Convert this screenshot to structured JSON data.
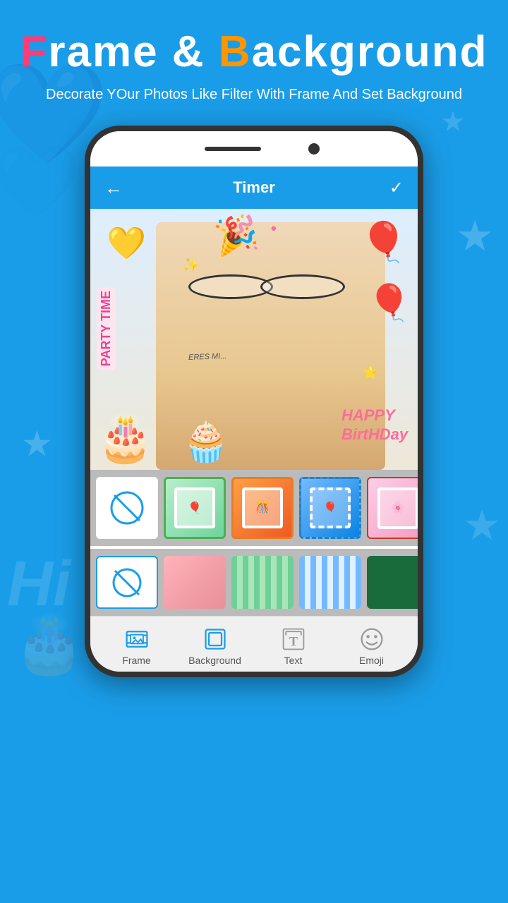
{
  "app": {
    "title_part1": "F",
    "title_rest1": "rame & ",
    "title_B": "B",
    "title_rest2": "ackground",
    "subtitle": "Decorate YOur Photos Like Filter With Frame And Set Background"
  },
  "header": {
    "back_icon": "←",
    "title": "Timer",
    "check_icon": "✓"
  },
  "frames": {
    "items": [
      {
        "id": "none",
        "label": "No frame"
      },
      {
        "id": "green",
        "label": "Green party frame"
      },
      {
        "id": "orange",
        "label": "Orange frame"
      },
      {
        "id": "blue",
        "label": "Blue party frame"
      },
      {
        "id": "pink",
        "label": "Pink frame"
      }
    ]
  },
  "backgrounds": {
    "items": [
      {
        "id": "none",
        "label": "No background"
      },
      {
        "id": "pink",
        "label": "Pink texture"
      },
      {
        "id": "green-stripes",
        "label": "Green stripes"
      },
      {
        "id": "blue-stripes",
        "label": "Blue stripes"
      },
      {
        "id": "dark-green",
        "label": "Dark green"
      }
    ]
  },
  "nav": {
    "items": [
      {
        "id": "frame",
        "label": "Frame",
        "active": true
      },
      {
        "id": "background",
        "label": "Background",
        "active": false
      },
      {
        "id": "text",
        "label": "Text",
        "active": false
      },
      {
        "id": "emoji",
        "label": "Emoji",
        "active": false
      }
    ]
  },
  "photo": {
    "party_text": "PARTY TIME",
    "birthday_text": "HAPPY\nBirtHDay",
    "balloon_left": "🎈",
    "balloon_right": "🎈",
    "cake": "🎂"
  }
}
